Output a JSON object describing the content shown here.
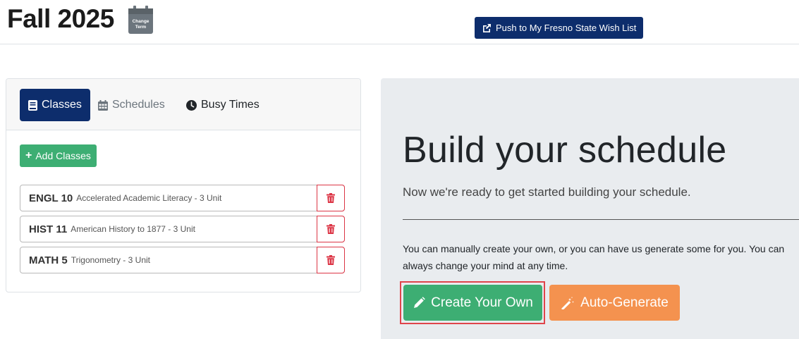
{
  "header": {
    "term": "Fall 2025",
    "change_term_label_line1": "Change",
    "change_term_label_line2": "Term",
    "push_label": "Push to My Fresno State Wish List"
  },
  "tabs": [
    {
      "label": "Classes",
      "icon": "book-icon",
      "active": true
    },
    {
      "label": "Schedules",
      "icon": "calendar-grid-icon",
      "active": false
    },
    {
      "label": "Busy Times",
      "icon": "clock-icon",
      "active": false
    }
  ],
  "add_classes_label": "Add Classes",
  "classes": [
    {
      "code": "ENGL 10",
      "desc": "Accelerated Academic Literacy - 3 Unit"
    },
    {
      "code": "HIST 11",
      "desc": "American History to 1877 - 3 Unit"
    },
    {
      "code": "MATH 5",
      "desc": "Trigonometry - 3 Unit"
    }
  ],
  "main": {
    "title": "Build your schedule",
    "subtitle": "Now we're ready to get started building your schedule.",
    "description": "You can manually create your own, or you can have us generate some for you. You can always change your mind at any time.",
    "create_label": "Create Your Own",
    "auto_label": "Auto-Generate"
  },
  "colors": {
    "navy": "#0d2d6c",
    "green": "#3dae73",
    "orange": "#f4924f",
    "danger": "#dc3545",
    "highlight": "#e0454b",
    "panel": "#e9ecef"
  }
}
